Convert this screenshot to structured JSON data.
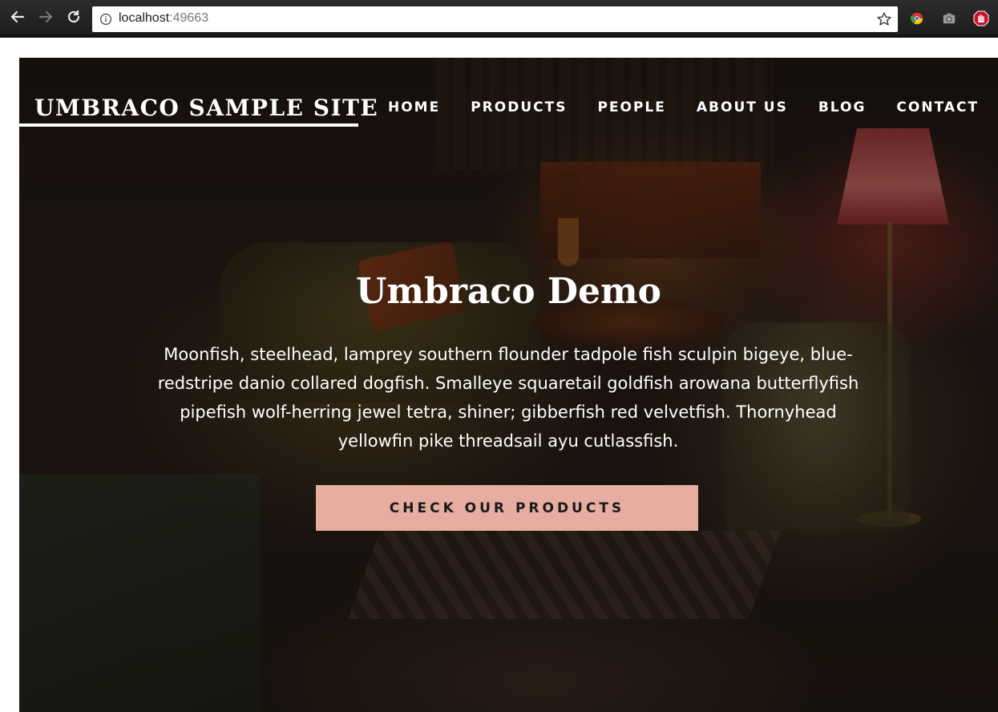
{
  "browser": {
    "url_host": "localhost",
    "url_port": ":49663",
    "icons": {
      "back": "back-arrow-icon",
      "forward": "forward-arrow-icon",
      "reload": "reload-icon",
      "site_info": "info-icon",
      "bookmark": "star-icon",
      "extensions": [
        "chrome-color-extension-icon",
        "camera-extension-icon",
        "hand-block-extension-icon"
      ]
    }
  },
  "site": {
    "brand": "UMBRACO SAMPLE SITE",
    "nav": {
      "home": "HOME",
      "products": "PRODUCTS",
      "people": "PEOPLE",
      "about": "ABOUT US",
      "blog": "BLOG",
      "contact": "CONTACT"
    }
  },
  "hero": {
    "title": "Umbraco Demo",
    "text": "Moonfish, steelhead, lamprey southern flounder tadpole fish sculpin bigeye, blue-redstripe danio collared dogfish. Smalleye squaretail goldfish arowana butterflyfish pipefish wolf-herring jewel tetra, shiner; gibberfish red velvetfish. Thornyhead yellowfin pike threadsail ayu cutlassfish.",
    "cta_label": "CHECK OUR PRODUCTS"
  },
  "colors": {
    "cta_background": "#e6ada0",
    "text": "#ffffff",
    "chrome": "#2b2b2b"
  }
}
